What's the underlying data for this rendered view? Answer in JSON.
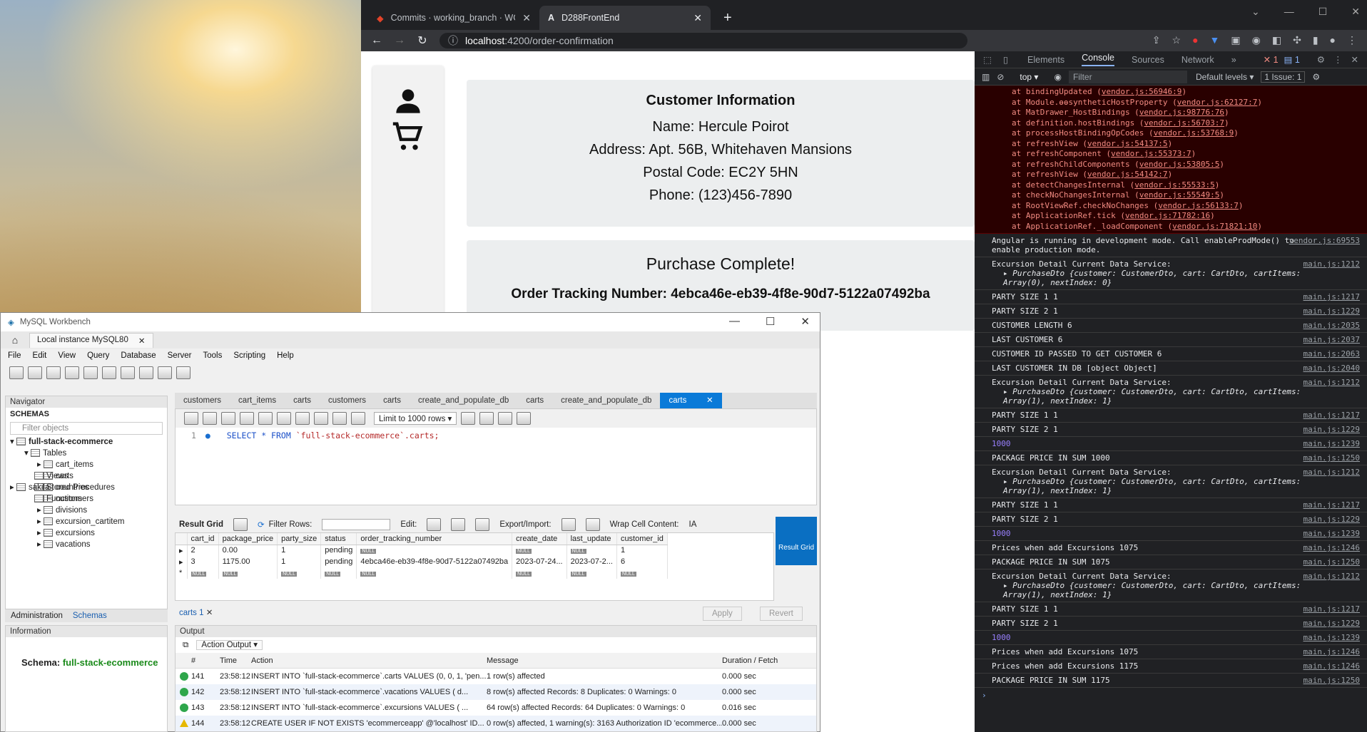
{
  "browser": {
    "tabs": [
      {
        "label": "Commits · working_branch · WGU"
      },
      {
        "label": "D288FrontEnd"
      }
    ],
    "url_host": "localhost",
    "url_path": ":4200/order-confirmation"
  },
  "page": {
    "customer_title": "Customer Information",
    "name": "Name: Hercule Poirot",
    "address": "Address: Apt. 56B, Whitehaven Mansions",
    "postal": "Postal Code: EC2Y 5HN",
    "phone": "Phone: (123)456-7890",
    "purchase_title": "Purchase Complete!",
    "tracking": "Order Tracking Number: 4ebca46e-eb39-4f8e-90d7-5122a07492ba"
  },
  "devtools": {
    "tabs": [
      "Elements",
      "Console",
      "Sources",
      "Network"
    ],
    "filter_placeholder": "Filter",
    "context": "top",
    "levels": "Default levels",
    "issues": "1 Issue: 1",
    "err_count": "1",
    "msg_count": "1",
    "stack": [
      {
        "fn": "at bindingUpdated",
        "src": "vendor.js:56946:9"
      },
      {
        "fn": "at Module.ɵɵsyntheticHostProperty",
        "src": "vendor.js:62127:7"
      },
      {
        "fn": "at MatDrawer_HostBindings",
        "src": "vendor.js:98776:76"
      },
      {
        "fn": "at definition.hostBindings",
        "src": "vendor.js:56703:7"
      },
      {
        "fn": "at processHostBindingOpCodes",
        "src": "vendor.js:53768:9"
      },
      {
        "fn": "at refreshView",
        "src": "vendor.js:54137:5"
      },
      {
        "fn": "at refreshComponent",
        "src": "vendor.js:55373:7"
      },
      {
        "fn": "at refreshChildComponents",
        "src": "vendor.js:53805:5"
      },
      {
        "fn": "at refreshView",
        "src": "vendor.js:54142:7"
      },
      {
        "fn": "at detectChangesInternal",
        "src": "vendor.js:55533:5"
      },
      {
        "fn": "at checkNoChangesInternal",
        "src": "vendor.js:55549:5"
      },
      {
        "fn": "at RootViewRef.checkNoChanges",
        "src": "vendor.js:56133:7"
      },
      {
        "fn": "at ApplicationRef.tick",
        "src": "vendor.js:71782:16"
      },
      {
        "fn": "at ApplicationRef._loadComponent",
        "src": "vendor.js:71821:10"
      }
    ],
    "logs": [
      {
        "text": "Angular is running in development mode. Call enableProdMode() to enable production mode.",
        "src": "vendor.js:69553",
        "lines": 2
      },
      {
        "text": "Excursion Detail Current Data Service:",
        "src": "main.js:1212",
        "obj": "PurchaseDto {customer: CustomerDto, cart: CartDto, cartItems: Array(0), nextIndex: 0}",
        "lines": 3
      },
      {
        "text": "PARTY SIZE 1 1",
        "src": "main.js:1217"
      },
      {
        "text": "PARTY SIZE 2 1",
        "src": "main.js:1229"
      },
      {
        "text": "CUSTOMER LENGTH 6",
        "src": "main.js:2035"
      },
      {
        "text": "LAST CUSTOMER 6",
        "src": "main.js:2037"
      },
      {
        "text": "CUSTOMER ID PASSED TO GET CUSTOMER 6",
        "src": "main.js:2063"
      },
      {
        "text": "LAST CUSTOMER IN DB [object Object]",
        "src": "main.js:2040"
      },
      {
        "text": "Excursion Detail Current Data Service:",
        "src": "main.js:1212",
        "obj": "PurchaseDto {customer: CustomerDto, cart: CartDto, cartItems: Array(1), nextIndex: 1}",
        "lines": 3
      },
      {
        "text": "PARTY SIZE 1 1",
        "src": "main.js:1217"
      },
      {
        "text": "PARTY SIZE 2 1",
        "src": "main.js:1229"
      },
      {
        "text": "1000",
        "src": "main.js:1239",
        "num": true
      },
      {
        "text": "PACKAGE PRICE IN SUM 1000",
        "src": "main.js:1250"
      },
      {
        "text": "Excursion Detail Current Data Service:",
        "src": "main.js:1212",
        "obj": "PurchaseDto {customer: CustomerDto, cart: CartDto, cartItems: Array(1), nextIndex: 1}",
        "lines": 3
      },
      {
        "text": "PARTY SIZE 1 1",
        "src": "main.js:1217"
      },
      {
        "text": "PARTY SIZE 2 1",
        "src": "main.js:1229"
      },
      {
        "text": "1000",
        "src": "main.js:1239",
        "num": true
      },
      {
        "text": "Prices when add Excursions 1075",
        "src": "main.js:1246"
      },
      {
        "text": "PACKAGE PRICE IN SUM 1075",
        "src": "main.js:1250"
      },
      {
        "text": "Excursion Detail Current Data Service:",
        "src": "main.js:1212",
        "obj": "PurchaseDto {customer: CustomerDto, cart: CartDto, cartItems: Array(1), nextIndex: 1}",
        "lines": 3
      },
      {
        "text": "PARTY SIZE 1 1",
        "src": "main.js:1217"
      },
      {
        "text": "PARTY SIZE 2 1",
        "src": "main.js:1229"
      },
      {
        "text": "1000",
        "src": "main.js:1239",
        "num": true
      },
      {
        "text": "Prices when add Excursions 1075",
        "src": "main.js:1246"
      },
      {
        "text": "Prices when add Excursions 1175",
        "src": "main.js:1246"
      },
      {
        "text": "PACKAGE PRICE IN SUM 1175",
        "src": "main.js:1250"
      }
    ]
  },
  "workbench": {
    "title": "MySQL Workbench",
    "connection": "Local instance MySQL80",
    "menu": [
      "File",
      "Edit",
      "View",
      "Query",
      "Database",
      "Server",
      "Tools",
      "Scripting",
      "Help"
    ],
    "navigator_title": "Navigator",
    "schemas_label": "SCHEMAS",
    "filter_placeholder": "Filter objects",
    "schema": "full-stack-ecommerce",
    "tables_label": "Tables",
    "tables": [
      "cart_items",
      "carts",
      "countries",
      "customers",
      "divisions",
      "excursion_cartitem",
      "excursions",
      "vacations"
    ],
    "other_nodes": [
      "Views",
      "Stored Procedures",
      "Functions"
    ],
    "schema2": "sakila",
    "nav_tabs": [
      "Administration",
      "Schemas"
    ],
    "info_title": "Information",
    "info_schema_label": "Schema:",
    "info_schema": "full-stack-ecommerce",
    "query_tabs": [
      "customers",
      "cart_items",
      "carts",
      "customers",
      "carts",
      "create_and_populate_db",
      "carts",
      "create_and_populate_db",
      "carts"
    ],
    "limit": "Limit to 1000 rows",
    "line_no": "1",
    "sql_kw": "SELECT * FROM ",
    "sql_tbl": "`full-stack-ecommerce`.carts;",
    "result_grid": "Result Grid",
    "filter_rows": "Filter Rows:",
    "edit": "Edit:",
    "export": "Export/Import:",
    "wrap": "Wrap Cell Content:",
    "columns": [
      "cart_id",
      "package_price",
      "party_size",
      "status",
      "order_tracking_number",
      "create_date",
      "last_update",
      "customer_id"
    ],
    "rows": [
      [
        "2",
        "0.00",
        "1",
        "pending",
        "NULL",
        "NULL",
        "NULL",
        "1"
      ],
      [
        "3",
        "1175.00",
        "1",
        "pending",
        "4ebca46e-eb39-4f8e-90d7-5122a07492ba",
        "2023-07-24...",
        "2023-07-2...",
        "6"
      ]
    ],
    "result_tab": "carts 1",
    "apply": "Apply",
    "revert": "Revert",
    "side_rg": "Result Grid",
    "output_title": "Output",
    "action_output": "Action Output",
    "out_cols": [
      "#",
      "Time",
      "Action",
      "Message",
      "Duration / Fetch"
    ],
    "out_rows": [
      {
        "n": "141",
        "t": "23:58:12",
        "a": "INSERT INTO `full-stack-ecommerce`.carts VALUES (0, 0, 1, 'pen...",
        "m": "1 row(s) affected",
        "d": "0.000 sec",
        "s": "ok"
      },
      {
        "n": "142",
        "t": "23:58:12",
        "a": "INSERT INTO `full-stack-ecommerce`.vacations VALUES (      d...",
        "m": "8 row(s) affected Records: 8  Duplicates: 0  Warnings: 0",
        "d": "0.000 sec",
        "s": "ok"
      },
      {
        "n": "143",
        "t": "23:58:12",
        "a": "INSERT INTO `full-stack-ecommerce`.excursions VALUES (     ...",
        "m": "64 row(s) affected Records: 64  Duplicates: 0  Warnings: 0",
        "d": "0.016 sec",
        "s": "ok"
      },
      {
        "n": "144",
        "t": "23:58:12",
        "a": "CREATE USER IF NOT EXISTS 'ecommerceapp' @'localhost' ID...",
        "m": "0 row(s) affected, 1 warning(s): 3163 Authorization ID 'ecommerce...",
        "d": "0.000 sec",
        "s": "warn"
      }
    ]
  }
}
